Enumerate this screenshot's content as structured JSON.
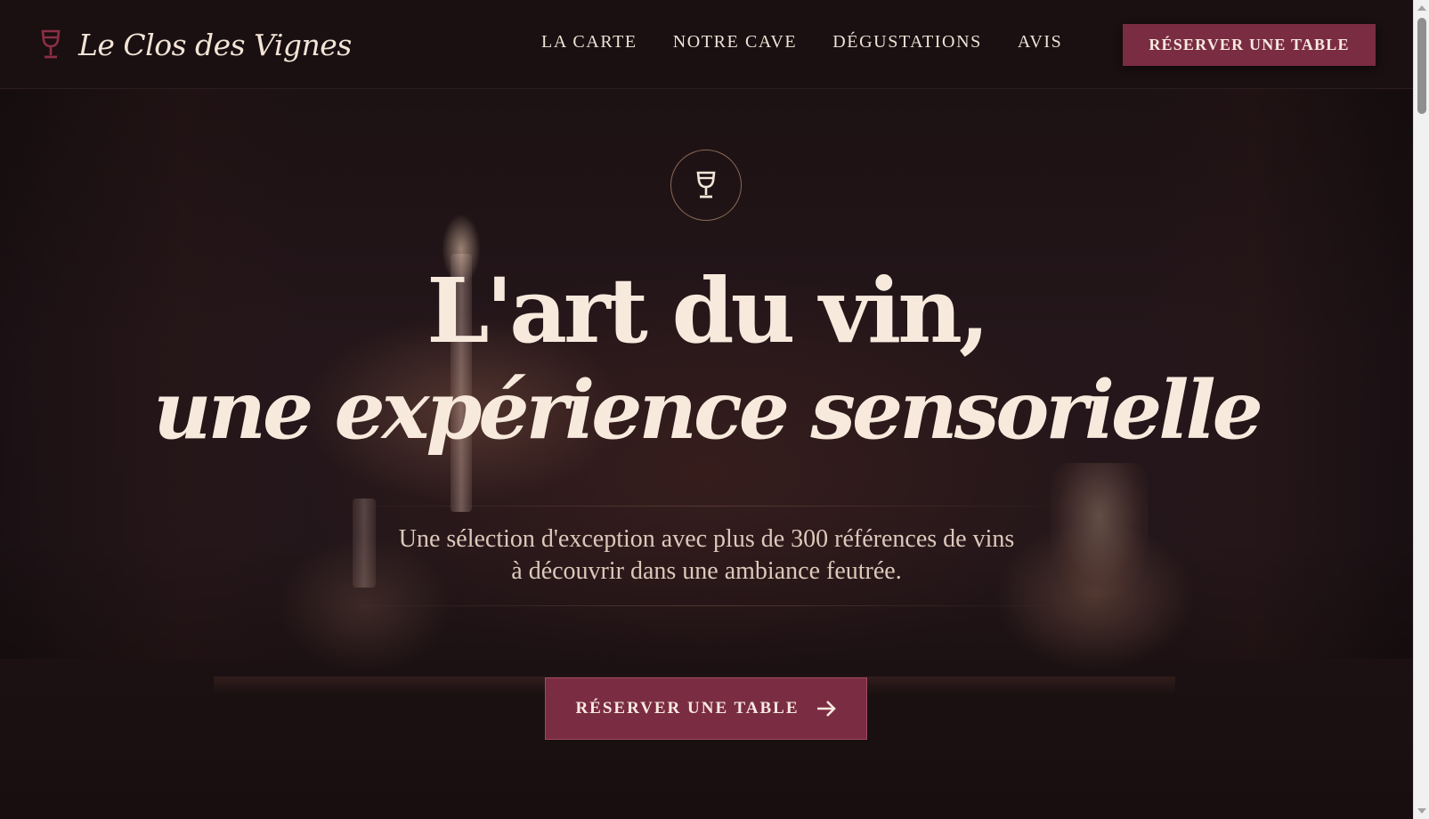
{
  "brand": {
    "name": "Le Clos des Vignes",
    "icon": "wine-glass-icon",
    "accent_color": "#7a2c42"
  },
  "nav": {
    "items": [
      {
        "label": "LA CARTE"
      },
      {
        "label": "NOTRE CAVE"
      },
      {
        "label": "DÉGUSTATIONS"
      },
      {
        "label": "AVIS"
      }
    ],
    "cta_label": "RÉSERVER UNE TABLE"
  },
  "hero": {
    "emblem_icon": "wine-glass-icon",
    "title_line1": "L'art du vin,",
    "title_line2": "une expérience sensorielle",
    "subtitle_line1": "Une sélection d'exception avec plus de 300 références de vins",
    "subtitle_line2": "à découvrir dans une ambiance feutrée.",
    "cta_label": "RÉSERVER UNE TABLE",
    "cta_icon": "arrow-right-icon"
  },
  "colors": {
    "background": "#1a0f11",
    "text_light": "#f7eadd",
    "button": "#7a2c42"
  }
}
